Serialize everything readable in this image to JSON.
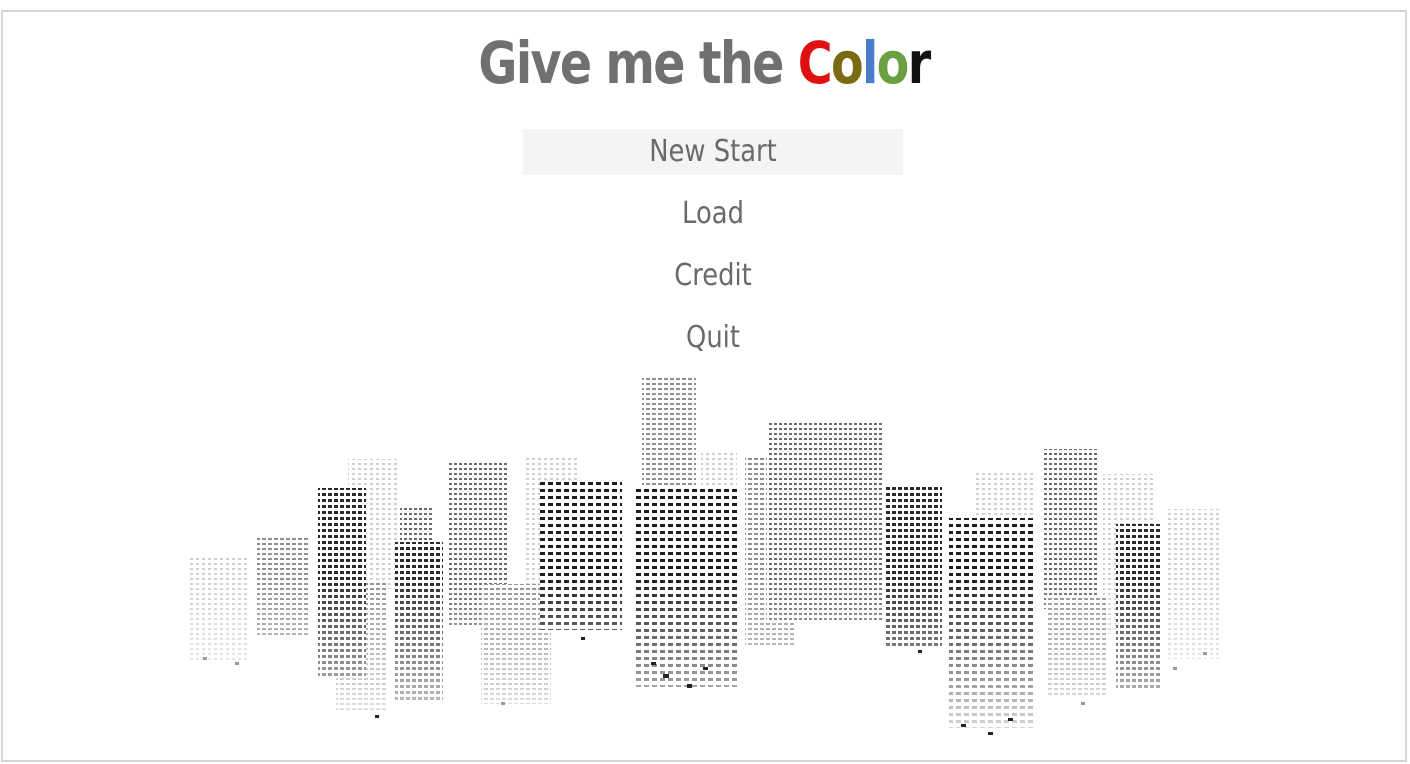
{
  "title": {
    "prefix": "Give me the ",
    "colored_letters": [
      {
        "char": "C",
        "color": "#e01010"
      },
      {
        "char": "o",
        "color": "#7a6a10"
      },
      {
        "char": "l",
        "color": "#4a7ccc"
      },
      {
        "char": "o",
        "color": "#6aa040"
      },
      {
        "char": "r",
        "color": "#111111"
      }
    ]
  },
  "menu": {
    "items": [
      {
        "label": "New Start",
        "selected": true
      },
      {
        "label": "Load",
        "selected": false
      },
      {
        "label": "Credit",
        "selected": false
      },
      {
        "label": "Quit",
        "selected": false
      }
    ]
  },
  "colors": {
    "text": "#6a6a6a",
    "selected_bg": "#f3f4f4",
    "border": "#d6d6d6"
  }
}
